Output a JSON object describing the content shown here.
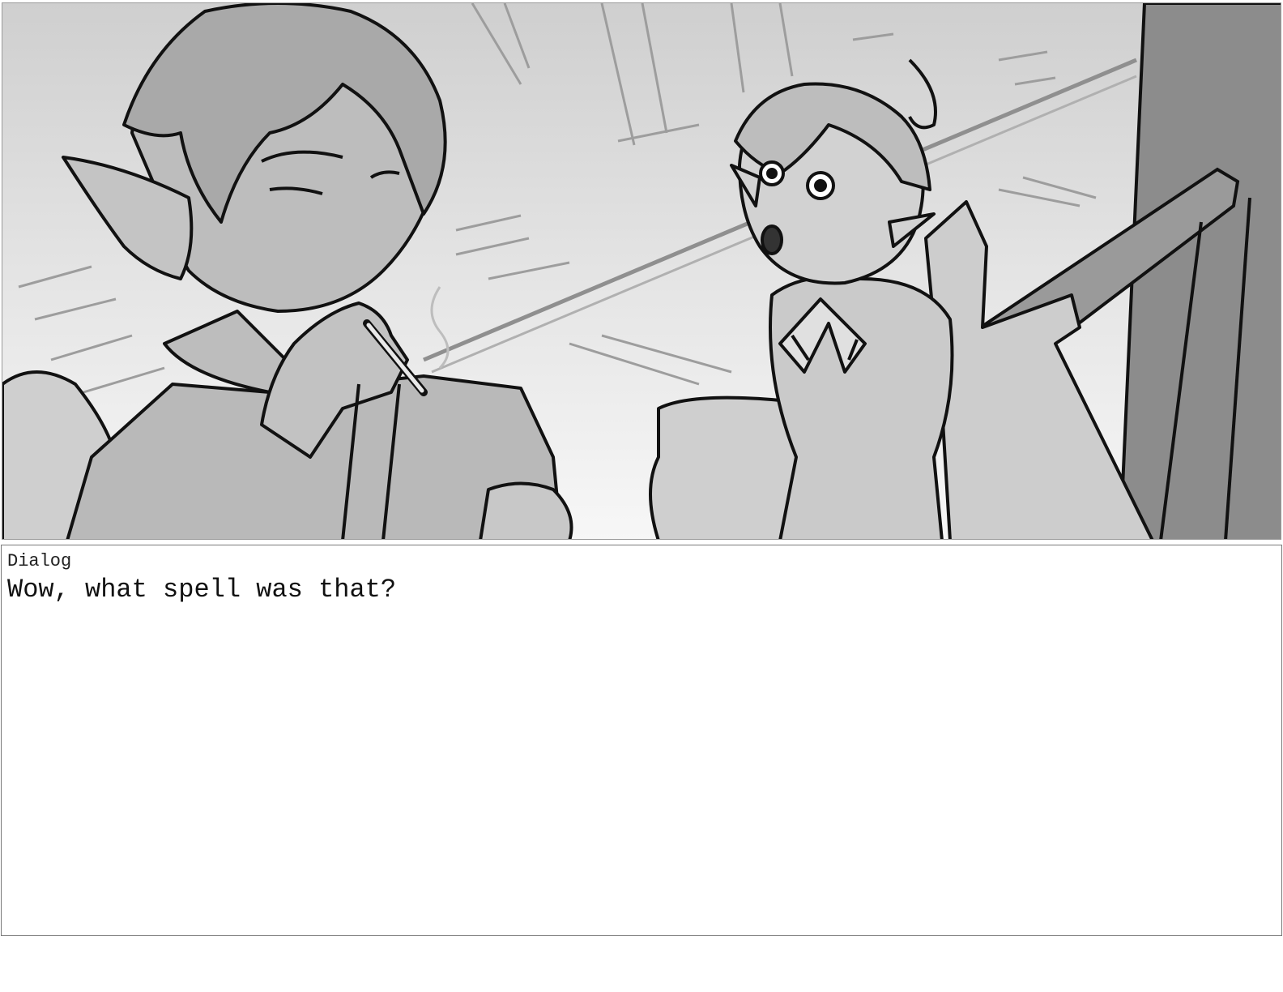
{
  "storyboard": {
    "panel": {
      "scene_icon": "illustration-scene-icon",
      "colors": {
        "line": "#111111",
        "bg_light": "#f4f4f4",
        "bg_mid": "#d6d6d6",
        "skin": "#c9c9c9",
        "wall_dark": "#8a8a8a"
      }
    },
    "dialog": {
      "label": "Dialog",
      "text": "Wow, what spell was that?"
    }
  }
}
